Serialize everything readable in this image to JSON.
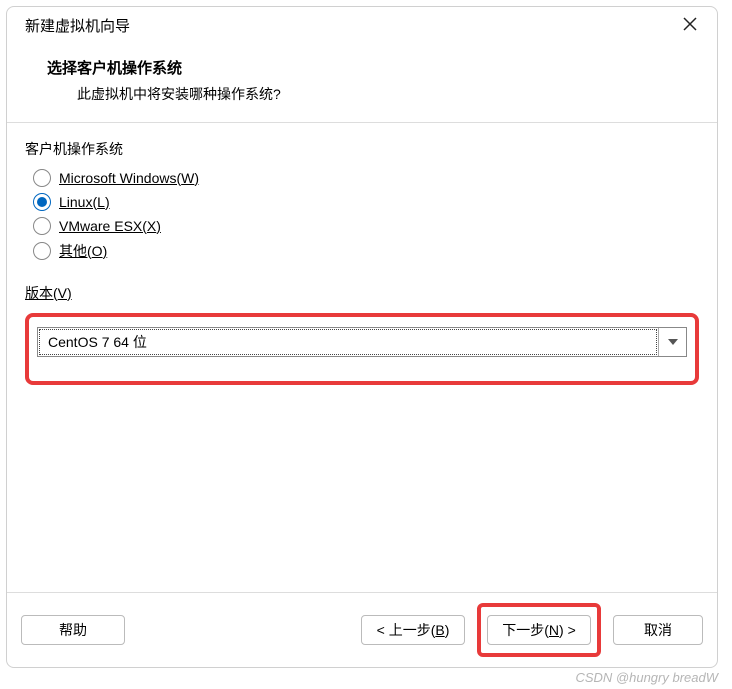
{
  "title": "新建虚拟机向导",
  "header": {
    "title": "选择客户机操作系统",
    "subtitle": "此虚拟机中将安装哪种操作系统?"
  },
  "osGroup": {
    "label_pre": "客户机操作系统",
    "options": {
      "windows": {
        "pre": "Microsoft Windows(",
        "u": "W",
        "post": ")"
      },
      "linux": {
        "pre": "Linux(",
        "u": "L",
        "post": ")"
      },
      "esx": {
        "pre": "VMware ESX(",
        "u": "X",
        "post": ")"
      },
      "other": {
        "pre": "其他(",
        "u": "O",
        "post": ")"
      }
    }
  },
  "version": {
    "label_pre": "版本(",
    "label_u": "V",
    "label_post": ")",
    "value": "CentOS 7 64 位"
  },
  "buttons": {
    "help": "帮助",
    "back_pre": "< 上一步(",
    "back_u": "B",
    "back_post": ")",
    "next_pre": "下一步(",
    "next_u": "N",
    "next_post": ") >",
    "cancel": "取消"
  },
  "watermark": "CSDN @hungry breadW"
}
